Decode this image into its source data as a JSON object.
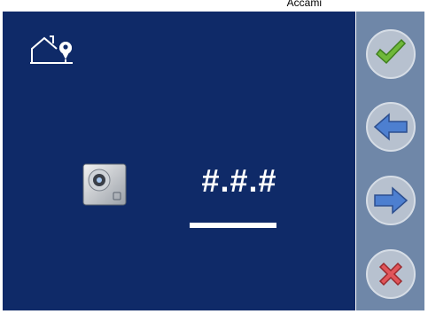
{
  "caption": {
    "text": "Accami"
  },
  "screen": {
    "code": "#.#.#",
    "house_icon": "house-location-icon",
    "panel_icon": "door-entry-panel-icon"
  },
  "sidebar": {
    "buttons": [
      {
        "name": "confirm",
        "icon": "checkmark-icon",
        "color": "#6fb83a"
      },
      {
        "name": "back",
        "icon": "arrow-left-icon",
        "color": "#4d7fd0"
      },
      {
        "name": "forward",
        "icon": "arrow-right-icon",
        "color": "#4d7fd0"
      },
      {
        "name": "cancel",
        "icon": "cross-icon",
        "color": "#e0555a"
      }
    ]
  },
  "colors": {
    "screen_bg": "#0f2a68",
    "sidebar_bg": "#6f87a8",
    "button_bg": "#b7c1cf"
  }
}
